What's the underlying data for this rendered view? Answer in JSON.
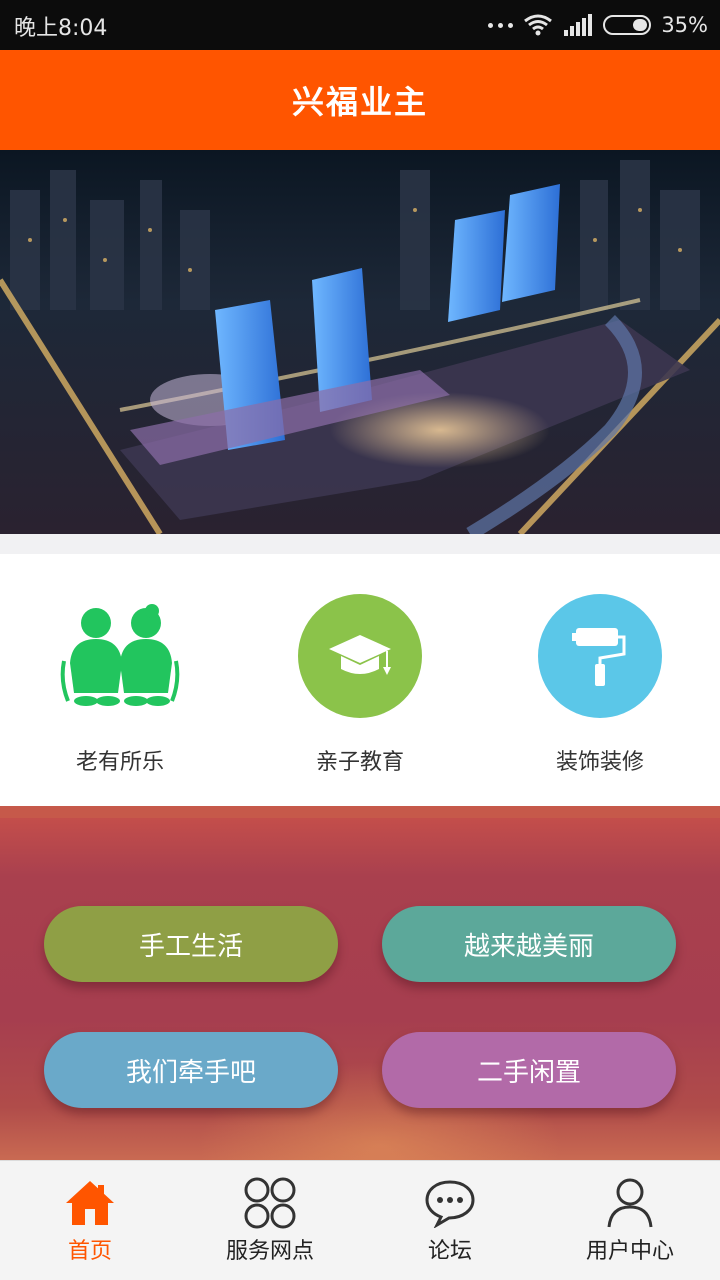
{
  "status_bar": {
    "time": "晚上8:04",
    "battery": "35%",
    "battery_level": 0.35
  },
  "header": {
    "title": "兴福业主"
  },
  "banner": {
    "slides": 4,
    "active_index": 0
  },
  "features": [
    {
      "label": "老有所乐",
      "icon": "elderly-couple-icon",
      "color": "#22c55e"
    },
    {
      "label": "亲子教育",
      "icon": "graduation-cap-icon",
      "color": "#8bc34a"
    },
    {
      "label": "装饰装修",
      "icon": "paint-roller-icon",
      "color": "#5bc7e8"
    }
  ],
  "promo": {
    "buttons": [
      {
        "label": "手工生活",
        "color": "#8f9f45"
      },
      {
        "label": "越来越美丽",
        "color": "#5ca89a"
      },
      {
        "label": "我们牵手吧",
        "color": "#6aa9c9"
      },
      {
        "label": "二手闲置",
        "color": "#b26aa8"
      }
    ]
  },
  "tabbar": {
    "active_color": "#ff5500",
    "tabs": [
      {
        "label": "首页",
        "icon": "home-icon",
        "active": true
      },
      {
        "label": "服务网点",
        "icon": "grid-icon",
        "active": false
      },
      {
        "label": "论坛",
        "icon": "chat-bubble-icon",
        "active": false
      },
      {
        "label": "用户中心",
        "icon": "user-icon",
        "active": false
      }
    ]
  }
}
